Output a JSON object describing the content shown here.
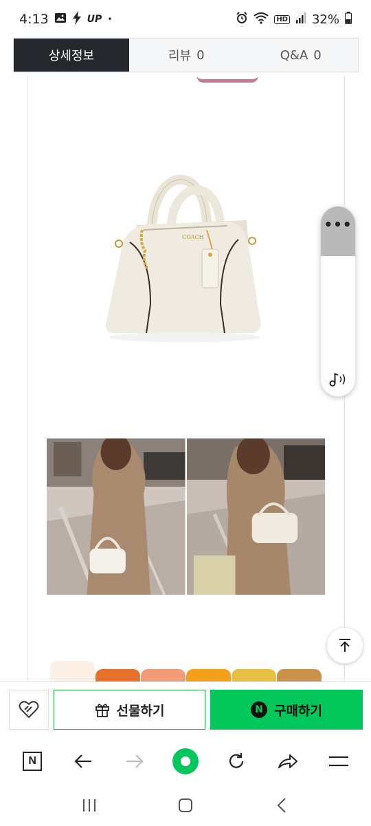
{
  "status_bar": {
    "time": "4:13",
    "up_label": "UP",
    "dot": "•",
    "hd_label": "HD",
    "battery": "32%"
  },
  "tabs": [
    {
      "label": "상세정보",
      "count": ""
    },
    {
      "label": "리뷰",
      "count": "0"
    },
    {
      "label": "Q&A",
      "count": "0"
    }
  ],
  "product": {
    "brand_mark": "COACH"
  },
  "floating": {
    "menu_dots": "•••"
  },
  "purchase": {
    "gift_label": "선물하기",
    "buy_label": "구매하기",
    "n_mark": "N"
  },
  "browser": {
    "n_mark": "N"
  },
  "colors": {
    "accent": "#03c75a",
    "tab_active_bg": "#24272b"
  },
  "swatches": [
    "#fdf1e7",
    "#e8712c",
    "#f29b7a",
    "#f5a01c",
    "#e6c045",
    "#c9914b"
  ]
}
